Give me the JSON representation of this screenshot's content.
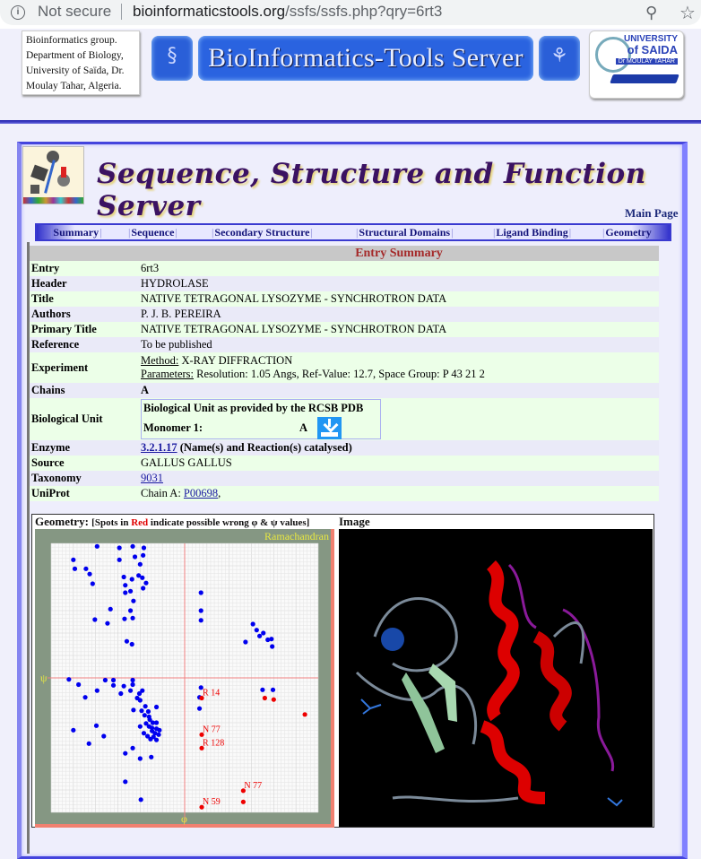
{
  "browser": {
    "security_label": "Not secure",
    "url_host": "bioinformaticstools.org",
    "url_path": "/ssfs/ssfs.php?qry=6rt3",
    "icons": [
      "info-icon",
      "zoom-icon",
      "star-icon"
    ]
  },
  "site_header": {
    "group_lines": [
      "Bioinformatics group.",
      "Department of Biology,",
      "University of Saïda, Dr.",
      "Moulay Tahar, Algeria."
    ],
    "banner_title": "BioInformatics-Tools Server",
    "university_logo": {
      "line1": "UNIVERSITY",
      "line2": "of SAIDA",
      "line3": "Dr MOULAY TAHAR"
    }
  },
  "app": {
    "title": "Sequence, Structure and Function Server",
    "main_page_link": "Main Page"
  },
  "tabs": [
    {
      "label": "Summary"
    },
    {
      "label": "Sequence"
    },
    {
      "label": "Secondary Structure"
    },
    {
      "label": "Structural Domains"
    },
    {
      "label": "Ligand Binding"
    },
    {
      "label": "Geometry"
    }
  ],
  "entry_summary": {
    "heading": "Entry Summary",
    "entry": {
      "label": "Entry",
      "value": "6rt3"
    },
    "header": {
      "label": "Header",
      "value": "HYDROLASE"
    },
    "title": {
      "label": "Title",
      "value": "NATIVE TETRAGONAL LYSOZYME - SYNCHROTRON DATA"
    },
    "authors": {
      "label": "Authors",
      "value": "P. J. B. PEREIRA"
    },
    "primary_title": {
      "label": "Primary Title",
      "value": "NATIVE TETRAGONAL LYSOZYME - SYNCHROTRON DATA"
    },
    "reference": {
      "label": "Reference",
      "value": "To be published"
    },
    "experiment": {
      "label": "Experiment",
      "method_label": "Method:",
      "method_value": " X-RAY DIFFRACTION",
      "parameters_label": "Parameters:",
      "parameters_value": " Resolution: 1.05 Angs, Ref-Value: 12.7, Space Group: P 43 21 2"
    },
    "chains": {
      "label": "Chains",
      "value": "A"
    },
    "biological_unit": {
      "label": "Biological Unit",
      "caption": "Biological Unit as provided by the RCSB PDB",
      "monomer_label": "Monomer 1:",
      "monomer_chain": "A",
      "download_icon": "download-icon"
    },
    "enzyme": {
      "label": "Enzyme",
      "ec_link": "3.2.1.17",
      "suffix": " (Name(s) and Reaction(s) catalysed)"
    },
    "source": {
      "label": "Source",
      "value": "GALLUS GALLUS"
    },
    "taxonomy": {
      "label": "Taxonomy",
      "link": "9031"
    },
    "uniprot": {
      "label": "UniProt",
      "prefix": "Chain A: ",
      "link": "P00698",
      "suffix": ","
    }
  },
  "geometry": {
    "label": "Geometry:",
    "note_pre": "[Spots in ",
    "note_red": "Red",
    "note_post": " indicate possible wrong φ & ψ values]",
    "image_label": "Image"
  },
  "chart_data": {
    "type": "scatter",
    "title": "Ramachandran",
    "xlabel": "φ",
    "ylabel": "ψ",
    "xlim": [
      -180,
      180
    ],
    "ylim": [
      -180,
      180
    ],
    "grid": true,
    "colors": {
      "allowed": "#0000ee",
      "outlier": "#ee0000",
      "axis": "#f08080",
      "frame": "#859783",
      "title": "#e8e840"
    },
    "series": [
      {
        "name": "allowed",
        "points": [
          [
            -118,
            176
          ],
          [
            -88,
            174
          ],
          [
            -70,
            176
          ],
          [
            -55,
            174
          ],
          [
            -150,
            158
          ],
          [
            -148,
            146
          ],
          [
            -133,
            146
          ],
          [
            -128,
            139
          ],
          [
            -124,
            126
          ],
          [
            -88,
            158
          ],
          [
            -67,
            162
          ],
          [
            -56,
            164
          ],
          [
            -60,
            152
          ],
          [
            -82,
            135
          ],
          [
            -71,
            132
          ],
          [
            -62,
            137
          ],
          [
            -57,
            134
          ],
          [
            -52,
            127
          ],
          [
            -56,
            120
          ],
          [
            -80,
            124
          ],
          [
            -73,
            116
          ],
          [
            -80,
            114
          ],
          [
            -69,
            103
          ],
          [
            -100,
            92
          ],
          [
            -73,
            90
          ],
          [
            -70,
            80
          ],
          [
            -121,
            78
          ],
          [
            -81,
            79
          ],
          [
            -104,
            73
          ],
          [
            -78,
            49
          ],
          [
            -71,
            45
          ],
          [
            22,
            114
          ],
          [
            22,
            90
          ],
          [
            22,
            77
          ],
          [
            92,
            72
          ],
          [
            106,
            60
          ],
          [
            97,
            64
          ],
          [
            101,
            56
          ],
          [
            117,
            52
          ],
          [
            112,
            51
          ],
          [
            82,
            48
          ],
          [
            118,
            42
          ],
          [
            -156,
            -2
          ],
          [
            -143,
            -9
          ],
          [
            -107,
            -3
          ],
          [
            -96,
            -3
          ],
          [
            -96,
            -10
          ],
          [
            -70,
            -3
          ],
          [
            -82,
            -11
          ],
          [
            -70,
            -9
          ],
          [
            -73,
            -17
          ],
          [
            -118,
            -17
          ],
          [
            -86,
            -21
          ],
          [
            -134,
            -26
          ],
          [
            -61,
            -21
          ],
          [
            -57,
            -17
          ],
          [
            -64,
            -27
          ],
          [
            -60,
            -30
          ],
          [
            -53,
            -38
          ],
          [
            -38,
            -39
          ],
          [
            -58,
            -44
          ],
          [
            -69,
            -43
          ],
          [
            -49,
            -45
          ],
          [
            -54,
            -50
          ],
          [
            -48,
            -52
          ],
          [
            -47,
            -56
          ],
          [
            -43,
            -60
          ],
          [
            -38,
            -60
          ],
          [
            -52,
            -61
          ],
          [
            -48,
            -65
          ],
          [
            -60,
            -65
          ],
          [
            -44,
            -67
          ],
          [
            -38,
            -68
          ],
          [
            -34,
            -70
          ],
          [
            -44,
            -71
          ],
          [
            -40,
            -74
          ],
          [
            -35,
            -76
          ],
          [
            -55,
            -74
          ],
          [
            -50,
            -78
          ],
          [
            -42,
            -79
          ],
          [
            -46,
            -82
          ],
          [
            -38,
            -83
          ],
          [
            -150,
            -70
          ],
          [
            -109,
            -78
          ],
          [
            -129,
            -88
          ],
          [
            -119,
            -64
          ],
          [
            -70,
            -94
          ],
          [
            -80,
            -101
          ],
          [
            -60,
            -108
          ],
          [
            -45,
            -106
          ],
          [
            -80,
            -139
          ],
          [
            -59,
            -163
          ],
          [
            22,
            -13
          ],
          [
            20,
            -26
          ],
          [
            20,
            -41
          ],
          [
            105,
            -16
          ],
          [
            119,
            -16
          ]
        ]
      },
      {
        "name": "outlier",
        "points": [
          [
            23,
            -27
          ],
          [
            108,
            -27
          ],
          [
            120,
            -29
          ],
          [
            162,
            -49
          ],
          [
            23,
            -76
          ],
          [
            23,
            -94
          ],
          [
            79,
            -151
          ],
          [
            23,
            -173
          ],
          [
            79,
            -166
          ]
        ],
        "labels": [
          {
            "text": "R  14",
            "point": [
              23,
              -27
            ]
          },
          {
            "text": "N  77",
            "point": [
              23,
              -76
            ]
          },
          {
            "text": "R 128",
            "point": [
              23,
              -94
            ]
          },
          {
            "text": "N  77",
            "point": [
              79,
              -151
            ]
          },
          {
            "text": "N  59",
            "point": [
              23,
              -173
            ]
          }
        ]
      }
    ]
  }
}
